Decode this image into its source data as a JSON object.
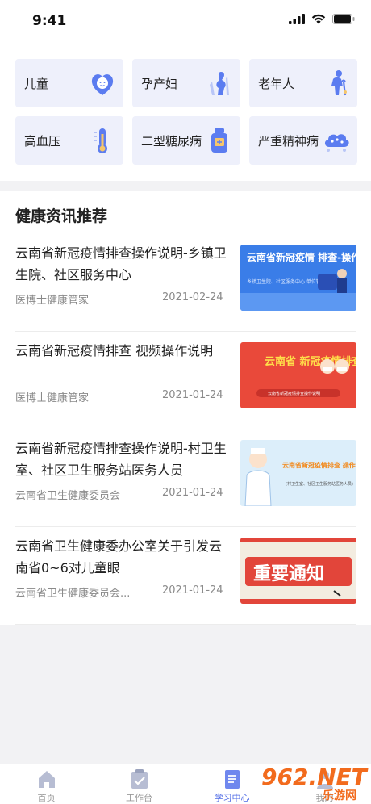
{
  "status": {
    "time": "9:41"
  },
  "categories": [
    {
      "label": "儿童",
      "icon": "baby-face-icon"
    },
    {
      "label": "孕产妇",
      "icon": "pregnant-woman-icon"
    },
    {
      "label": "老年人",
      "icon": "elderly-person-icon"
    },
    {
      "label": "高血压",
      "icon": "thermometer-icon"
    },
    {
      "label": "二型糖尿病",
      "icon": "medicine-bottle-icon"
    },
    {
      "label": "严重精神病",
      "icon": "brain-cloud-icon"
    }
  ],
  "news": {
    "heading": "健康资讯推荐",
    "items": [
      {
        "title": "云南省新冠疫情排查操作说明-乡镇卫生院、社区服务中心",
        "source": "医博士健康管家",
        "date": "2021-02-24",
        "thumb_text": "云南省新冠疫情 排查-操作说明",
        "thumb_sub": "乡镇卫生院、社区服务中心 单位管理员"
      },
      {
        "title": "云南省新冠疫情排查 视频操作说明",
        "source": "医博士健康管家",
        "date": "2021-01-24",
        "thumb_text": "云南省 新冠疫情排查",
        "thumb_sub": "云南省新冠疫情排查操作说明"
      },
      {
        "title": "云南省新冠疫情排查操作说明-村卫生室、社区卫生服务站医务人员",
        "source": "云南省卫生健康委员会",
        "date": "2021-01-24",
        "thumb_text": "云南省新冠疫情排查 操作说明",
        "thumb_sub": "(村卫生室、社区卫生服务站医务人员)"
      },
      {
        "title": "云南省卫生健康委办公室关于引发云南省0~6对儿童眼",
        "source": "云南省卫生健康委员会...",
        "date": "2021-01-24",
        "thumb_text": "重要通知",
        "thumb_sub": ""
      }
    ]
  },
  "tabs": [
    {
      "label": "首页",
      "icon": "home-icon"
    },
    {
      "label": "工作台",
      "icon": "clipboard-check-icon"
    },
    {
      "label": "学习中心",
      "icon": "document-icon",
      "active": true
    },
    {
      "label": "我的",
      "icon": "person-icon"
    }
  ],
  "watermark": {
    "brand": "962.NET",
    "site": "乐游网"
  },
  "colors": {
    "accent": "#4f6be6",
    "card_bg": "#eef0fb",
    "icon_blue": "#5b7cf0"
  }
}
